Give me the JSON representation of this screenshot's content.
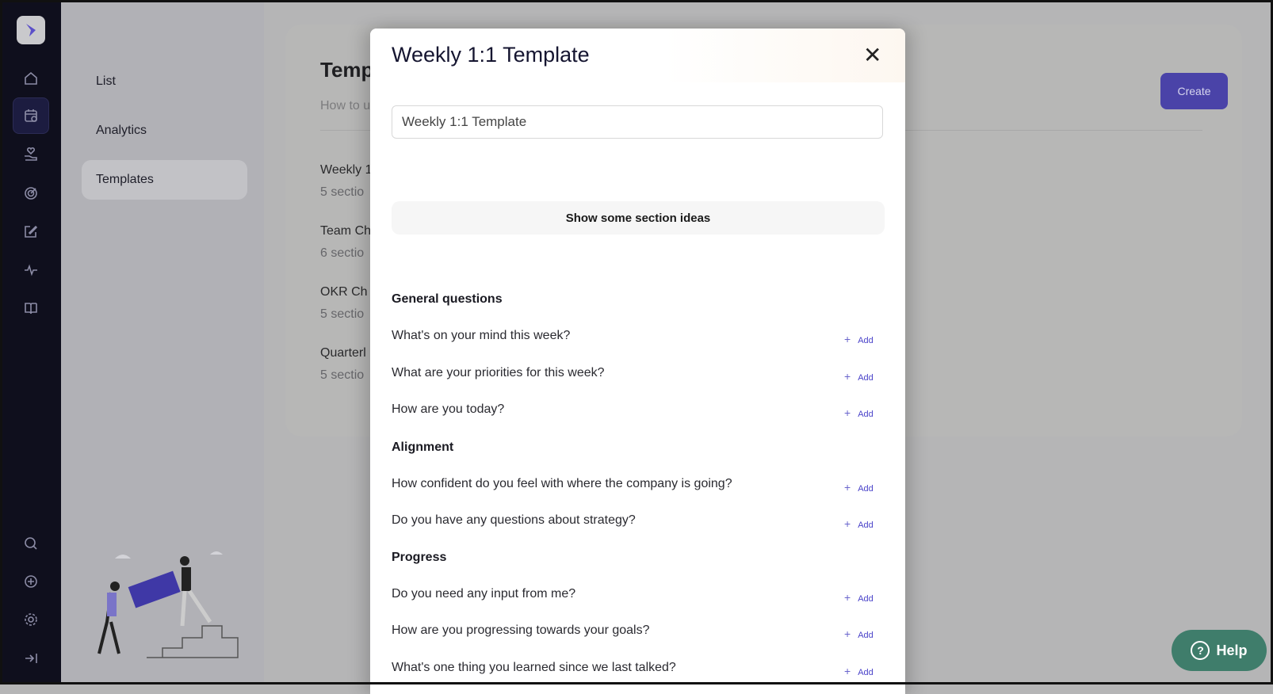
{
  "rail": {
    "icons": [
      "home-icon",
      "calendar-icon",
      "heart-hand-icon",
      "target-icon",
      "edit-icon",
      "activity-icon",
      "book-icon",
      "search-icon",
      "plus-circle-icon",
      "gear-icon",
      "collapse-icon"
    ],
    "active": "calendar-icon"
  },
  "subnav": {
    "items": [
      {
        "label": "List"
      },
      {
        "label": "Analytics"
      },
      {
        "label": "Templates",
        "active": true
      }
    ]
  },
  "page": {
    "title": "Temp",
    "subtitle": "How to u",
    "create_label": "Create",
    "templates": [
      {
        "name": "Weekly 1",
        "sections": "5 sectio"
      },
      {
        "name": "Team Ch",
        "sections": "6 sectio"
      },
      {
        "name": "OKR Ch",
        "sections": "5 sectio"
      },
      {
        "name": "Quarterl",
        "sections": "5 sectio"
      }
    ]
  },
  "modal": {
    "title": "Weekly 1:1 Template",
    "name_value": "Weekly 1:1 Template",
    "ideas_label": "Show some section ideas",
    "add_label": "Add",
    "groups": [
      {
        "heading": "General questions",
        "questions": [
          "What's on your mind this week?",
          "What are your priorities for this week?",
          "How are you today?"
        ]
      },
      {
        "heading": "Alignment",
        "questions": [
          "How confident do you feel with where the company is going?",
          "Do you have any questions about strategy?"
        ]
      },
      {
        "heading": "Progress",
        "questions": [
          "Do you need any input from me?",
          "How are you progressing towards your goals?",
          "What's one thing you learned since we last talked?"
        ]
      }
    ]
  },
  "help": {
    "label": "Help"
  },
  "colors": {
    "accent": "#4a43a8",
    "help": "#3f7d6b",
    "rail": "#0f0f1d"
  }
}
